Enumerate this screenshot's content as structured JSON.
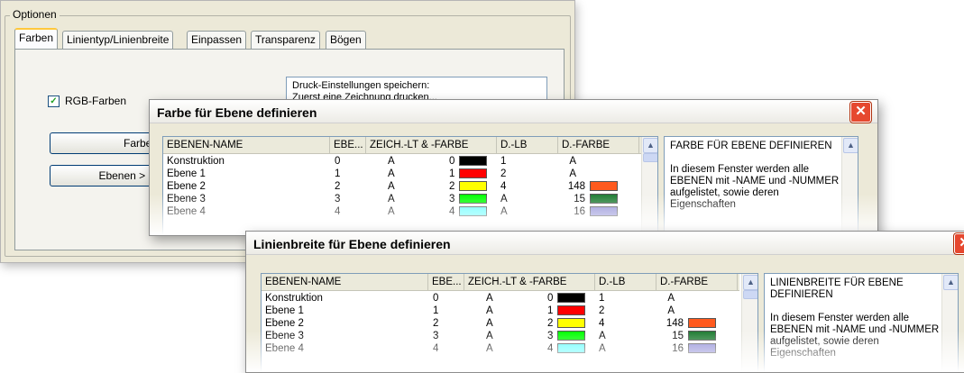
{
  "options": {
    "group_label": "Optionen",
    "tabs": [
      "Farben",
      "Linientyp/Linienbreite",
      "Einpassen",
      "Transparenz",
      "Bögen"
    ],
    "checkbox_label": "RGB-Farben",
    "checkbox_checked": true,
    "button1_label": "Farben",
    "button2_label": "Ebenen > Farben",
    "info_line1": "Druck-Einstellungen speichern:",
    "info_line2": "Zuerst eine Zeichnung drucken..."
  },
  "colors": {
    "black": "#000000",
    "red": "#ff0000",
    "yellow": "#ffff00",
    "green": "#00ff00",
    "cyan": "#66ffff",
    "orange": "#ff5a1e",
    "dark_green": "#1e7b32",
    "blue_gray": "#8e8cd6",
    "close_red": "#e6482f"
  },
  "table": {
    "headers": [
      "EBENEN-NAME",
      "EBE...",
      "ZEICH.-LT & -FARBE",
      "D.-LB",
      "D.-FARBE"
    ],
    "rows": [
      {
        "name": "Konstruktion",
        "num": "0",
        "lt": "A",
        "code": "0",
        "color": "#000000",
        "dlb": "1",
        "dfarbe": "A",
        "dcolor": ""
      },
      {
        "name": "Ebene 1",
        "num": "1",
        "lt": "A",
        "code": "1",
        "color": "#ff0000",
        "dlb": "2",
        "dfarbe": "A",
        "dcolor": ""
      },
      {
        "name": "Ebene 2",
        "num": "2",
        "lt": "A",
        "code": "2",
        "color": "#ffff00",
        "dlb": "4",
        "dfarbe": "148",
        "dcolor": "#ff5a1e"
      },
      {
        "name": "Ebene 3",
        "num": "3",
        "lt": "A",
        "code": "3",
        "color": "#00ff00",
        "dlb": "A",
        "dfarbe": "15",
        "dcolor": "#1e7b32"
      },
      {
        "name": "Ebene 4",
        "num": "4",
        "lt": "A",
        "code": "4",
        "color": "#66ffff",
        "dlb": "A",
        "dfarbe": "16",
        "dcolor": "#8e8cd6"
      }
    ]
  },
  "window1": {
    "title": "Farbe für Ebene definieren",
    "desc_title": "FARBE FÜR EBENE DEFINIEREN",
    "desc_body": "In diesem Fenster werden alle EBENEN mit -NAME und -NUMMER aufgelistet, sowie deren Eigenschaften"
  },
  "window2": {
    "title": "Linienbreite für Ebene definieren",
    "desc_title": "LINIENBREITE FÜR EBENE DEFINIEREN",
    "desc_body": "In diesem Fenster werden alle EBENEN mit -NAME und -NUMMER aufgelistet, sowie deren Eigenschaften"
  },
  "icons": {
    "close": "close-icon",
    "scroll_up": "scroll-up-arrow-icon",
    "check": "checkmark-icon"
  }
}
